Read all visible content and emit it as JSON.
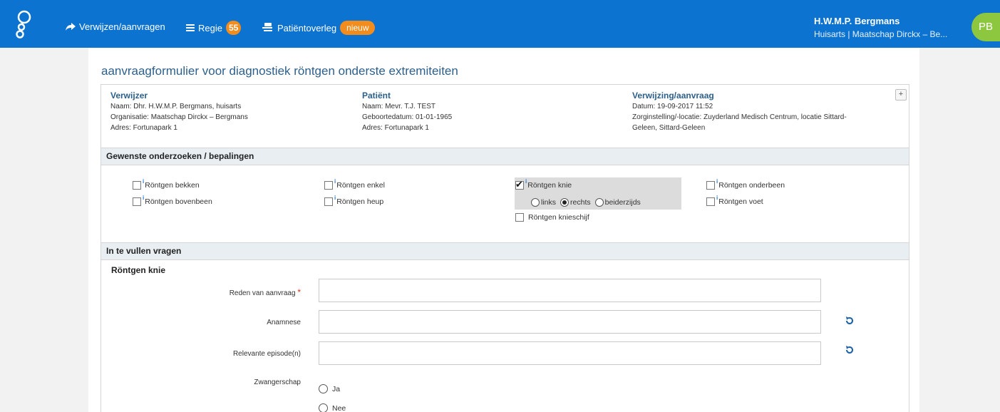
{
  "nav": {
    "verwijzen": "Verwijzen/aanvragen",
    "regie": "Regie",
    "regie_count": "55",
    "patientoverleg": "Patiëntoverleg",
    "nieuw": "nieuw"
  },
  "user": {
    "name": "H.W.M.P. Bergmans",
    "role": "Huisarts | Maatschap Dirckx – Be...",
    "initials": "PB"
  },
  "page": {
    "title": "aanvraagformulier voor diagnostiek röntgen onderste extremiteiten"
  },
  "info": {
    "verwijzer": {
      "head": "Verwijzer",
      "naam": "Naam: Dhr. H.W.M.P. Bergmans, huisarts",
      "organisatie": "Organisatie: Maatschap Dirckx – Bergmans",
      "adres": "Adres: Fortunapark 1"
    },
    "patient": {
      "head": "Patiënt",
      "naam": "Naam: Mevr. T.J. TEST",
      "geboortedatum": "Geboortedatum: 01-01-1965",
      "adres": "Adres: Fortunapark 1"
    },
    "verwijzing": {
      "head": "Verwijzing/aanvraag",
      "datum": "Datum: 19-09-2017 11:52",
      "zorginstelling_1": "Zorginstelling/-locatie: Zuyderland Medisch Centrum, locatie Sittard-",
      "zorginstelling_2": "Geleen, Sittard-Geleen"
    },
    "expand": "+"
  },
  "onderzoeken": {
    "head": "Gewenste onderzoeken / bepalingen",
    "items": {
      "bekken": "Röntgen bekken",
      "bovenbeen": "Röntgen bovenbeen",
      "enkel": "Röntgen enkel",
      "heup": "Röntgen heup",
      "knie": "Röntgen knie",
      "knieschijf": "Röntgen knieschijf",
      "onderbeen": "Röntgen onderbeen",
      "voet": "Röntgen voet"
    },
    "info_mark": "i",
    "side": {
      "links": "links",
      "rechts": "rechts",
      "beiderzijds": "beiderzijds",
      "selected": "rechts"
    }
  },
  "vragen": {
    "head": "In te vullen vragen",
    "title": "Röntgen knie",
    "reden": "Reden van aanvraag",
    "required_mark": "*",
    "anamnese": "Anamnese",
    "episoden": "Relevante episode(n)",
    "zwangerschap": "Zwangerschap",
    "ja": "Ja",
    "nee": "Nee"
  },
  "colors": {
    "topbar": "#0c73d1",
    "badge": "#f28c1c",
    "avatar": "#8dc63f",
    "title": "#2c5f8a"
  }
}
